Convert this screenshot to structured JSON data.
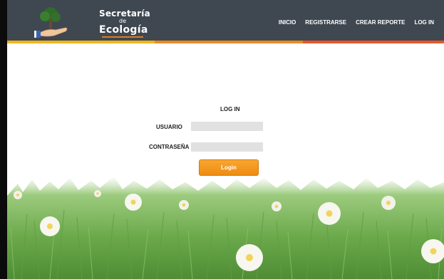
{
  "brand": {
    "line1": "Secretaría",
    "line2": "de",
    "line3": "Ecología"
  },
  "nav": {
    "items": [
      "INICIO",
      "REGISTRARSE",
      "CREAR REPORTE",
      "LOG IN"
    ]
  },
  "colors": {
    "header": "#3f4751",
    "stripe_left": "#f0b41e",
    "stripe_mid": "#ea8a24",
    "stripe_right": "#e3572a",
    "button": "#f29a1f"
  },
  "form": {
    "title": "LOG IN",
    "username_label": "USUARIO",
    "password_label": "CONTRASEÑA",
    "username_value": "",
    "password_value": "",
    "submit_label": "Login"
  }
}
